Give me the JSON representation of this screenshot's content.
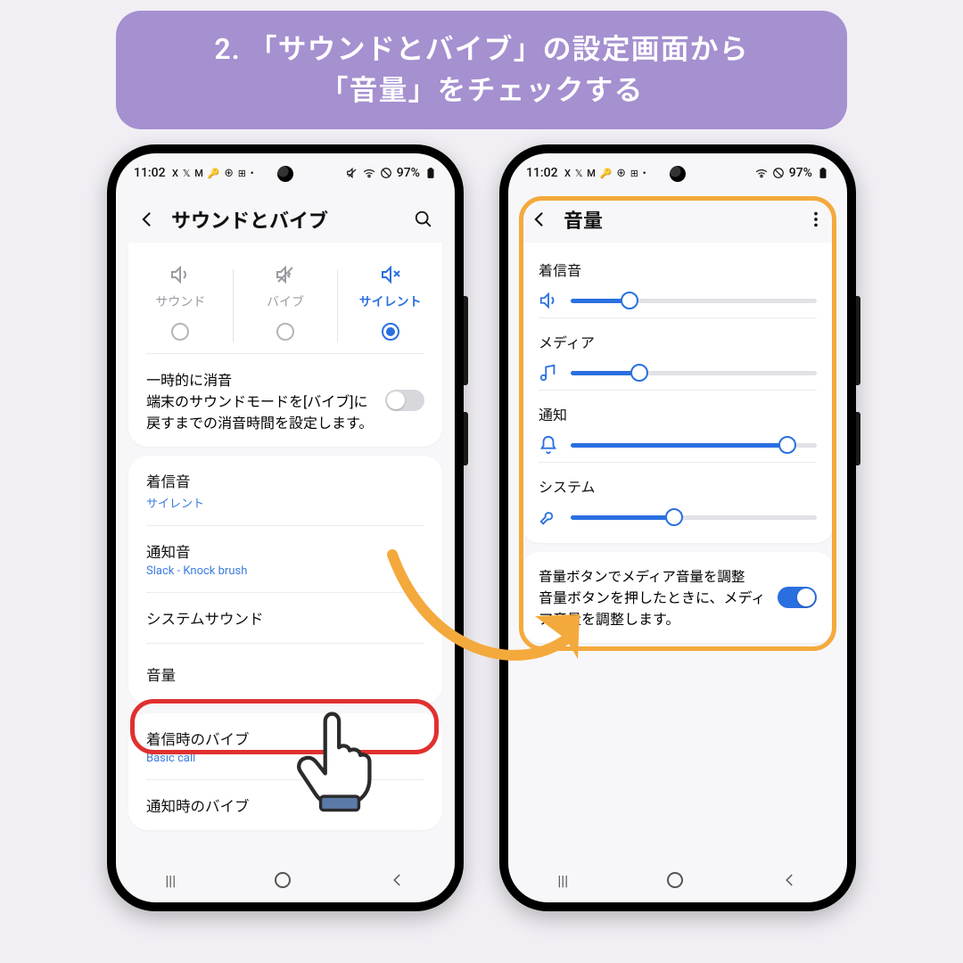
{
  "banner": {
    "line1": "2. 「サウンドとバイブ」の設定画面から",
    "line2": "「音量」をチェックする"
  },
  "status": {
    "time": "11:02",
    "icons_left": "X 𝕏 M 🔑 ⊕ ⊞ •",
    "battery": "97%"
  },
  "phone_left": {
    "header_title": "サウンドとバイブ",
    "modes": [
      {
        "label": "サウンド",
        "active": false
      },
      {
        "label": "バイブ",
        "active": false
      },
      {
        "label": "サイレント",
        "active": true
      }
    ],
    "temp_mute": {
      "title": "一時的に消音",
      "desc": "端末のサウンドモードを[バイブ]に戻すまでの消音時間を設定します。",
      "on": false
    },
    "items": {
      "ringtone": {
        "label": "着信音",
        "value": "サイレント"
      },
      "notif": {
        "label": "通知音",
        "value": "Slack - Knock brush"
      },
      "system": {
        "label": "システムサウンド"
      },
      "volume": {
        "label": "音量"
      },
      "call_vib": {
        "label": "着信時のバイブ",
        "value": "Basic call"
      },
      "notif_vib": {
        "label": "通知時のバイブ"
      }
    }
  },
  "phone_right": {
    "header_title": "音量",
    "sliders": {
      "ringtone": {
        "label": "着信音",
        "pct": 24
      },
      "media": {
        "label": "メディア",
        "pct": 28
      },
      "notif": {
        "label": "通知",
        "pct": 88
      },
      "system": {
        "label": "システム",
        "pct": 42
      }
    },
    "media_key": {
      "title": "音量ボタンでメディア音量を調整",
      "desc": "音量ボタンを押したときに、メディア音量を調整します。",
      "on": true
    }
  }
}
